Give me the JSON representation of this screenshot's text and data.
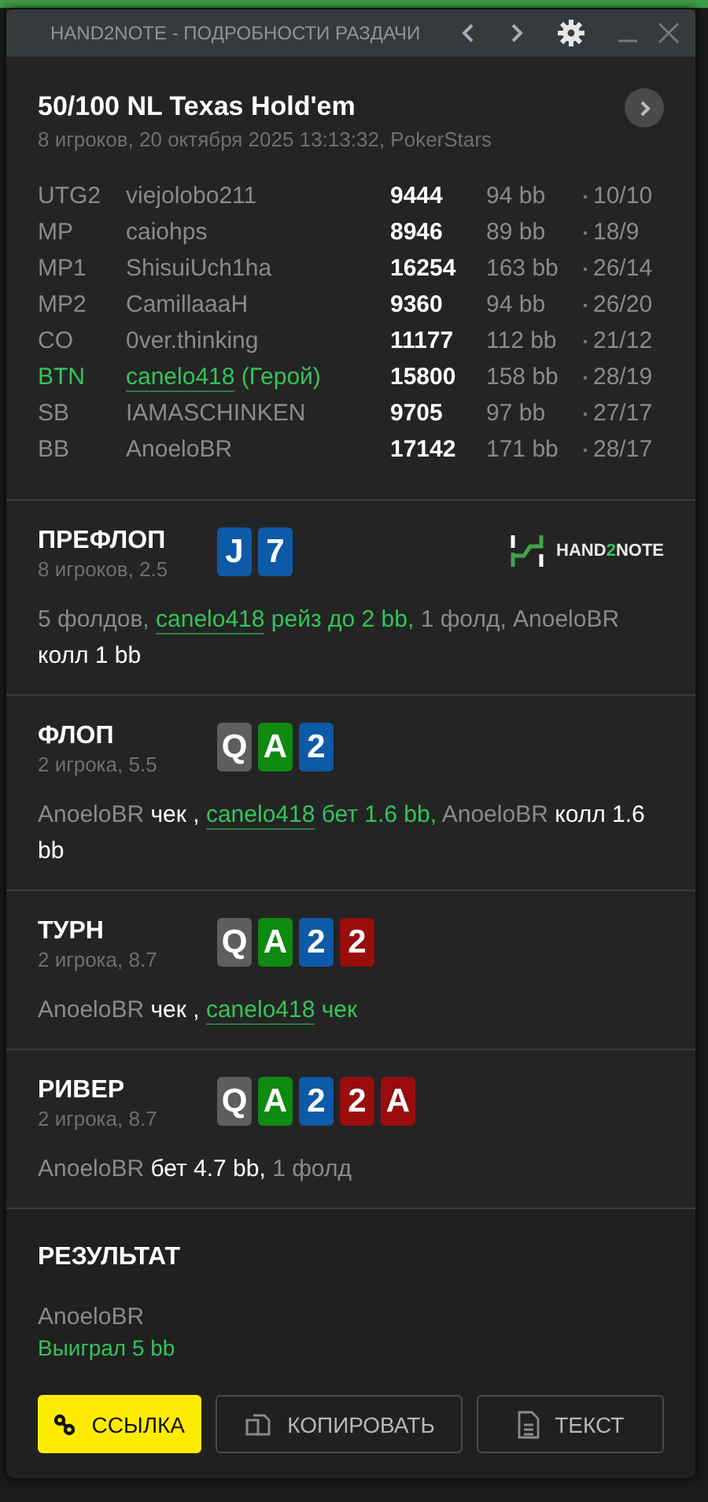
{
  "window": {
    "title": "HAND2NOTE - ПОДРОБНОСТИ РАЗДАЧИ"
  },
  "hand": {
    "title": "50/100 NL Texas Hold'em",
    "subtitle": "8 игроков, 20 октября 2025 13:13:32, PokerStars"
  },
  "players": [
    {
      "position": "UTG2",
      "name": "viejolobo211",
      "stack": "9444",
      "bb": "94 bb",
      "stats": "10/10",
      "hero": false
    },
    {
      "position": "MP",
      "name": "caiohps",
      "stack": "8946",
      "bb": "89 bb",
      "stats": "18/9",
      "hero": false
    },
    {
      "position": "MP1",
      "name": "ShisuiUch1ha",
      "stack": "16254",
      "bb": "163 bb",
      "stats": "26/14",
      "hero": false
    },
    {
      "position": "MP2",
      "name": "CamillaaaH",
      "stack": "9360",
      "bb": "94 bb",
      "stats": "26/20",
      "hero": false
    },
    {
      "position": "CO",
      "name": "0ver.thinking",
      "stack": "11177",
      "bb": "112 bb",
      "stats": "21/12",
      "hero": false
    },
    {
      "position": "BTN",
      "name": "canelo418",
      "tag": "(Герой)",
      "stack": "15800",
      "bb": "158 bb",
      "stats": "28/19",
      "hero": true
    },
    {
      "position": "SB",
      "name": "IAMASCHINKEN",
      "stack": "9705",
      "bb": "97 bb",
      "stats": "27/17",
      "hero": false
    },
    {
      "position": "BB",
      "name": "AnoeloBR",
      "stack": "17142",
      "bb": "171 bb",
      "stats": "28/17",
      "hero": false
    }
  ],
  "streets": [
    {
      "name": "ПРЕФЛОП",
      "info": "8 игроков, 2.5",
      "cards": [
        {
          "rank": "J",
          "color": "#0d5aa7"
        },
        {
          "rank": "7",
          "color": "#0d5aa7"
        }
      ],
      "logo": [
        {
          "text": "HAND",
          "accent": false
        },
        {
          "text": "2",
          "accent": true
        },
        {
          "text": "NOTE",
          "accent": false
        }
      ],
      "actions": [
        {
          "text": "5 фолдов, ",
          "kind": "dim"
        },
        {
          "text": "canelo418",
          "kind": "hero"
        },
        {
          "text": " рейз до 2 bb,",
          "kind": "hero_move"
        },
        {
          "text": " 1 фолд, AnoeloBR ",
          "kind": "dim"
        },
        {
          "text": "колл 1 bb",
          "kind": "move"
        }
      ]
    },
    {
      "name": "ФЛОП",
      "info": "2 игрока, 5.5",
      "cards": [
        {
          "rank": "Q",
          "color": "#5e5e5e"
        },
        {
          "rank": "A",
          "color": "#0e8a10"
        },
        {
          "rank": "2",
          "color": "#0d5aa7"
        }
      ],
      "actions": [
        {
          "text": "AnoeloBR ",
          "kind": "dim"
        },
        {
          "text": "чек , ",
          "kind": "move"
        },
        {
          "text": "canelo418",
          "kind": "hero"
        },
        {
          "text": " бет 1.6 bb,",
          "kind": "hero_move"
        },
        {
          "text": " AnoeloBR ",
          "kind": "dim"
        },
        {
          "text": "колл 1.6 bb",
          "kind": "move"
        }
      ]
    },
    {
      "name": "ТУРН",
      "info": "2 игрока, 8.7",
      "cards": [
        {
          "rank": "Q",
          "color": "#5e5e5e"
        },
        {
          "rank": "A",
          "color": "#0e8a10"
        },
        {
          "rank": "2",
          "color": "#0d5aa7"
        },
        {
          "rank": "2",
          "color": "#990d0d"
        }
      ],
      "actions": [
        {
          "text": "AnoeloBR ",
          "kind": "dim"
        },
        {
          "text": "чек , ",
          "kind": "move"
        },
        {
          "text": "canelo418",
          "kind": "hero"
        },
        {
          "text": " чек",
          "kind": "hero_move"
        }
      ]
    },
    {
      "name": "РИВЕР",
      "info": "2 игрока, 8.7",
      "cards": [
        {
          "rank": "Q",
          "color": "#5e5e5e"
        },
        {
          "rank": "A",
          "color": "#0e8a10"
        },
        {
          "rank": "2",
          "color": "#0d5aa7"
        },
        {
          "rank": "2",
          "color": "#990d0d"
        },
        {
          "rank": "A",
          "color": "#990d0d"
        }
      ],
      "actions": [
        {
          "text": "AnoeloBR ",
          "kind": "dim"
        },
        {
          "text": "бет 4.7 bb,",
          "kind": "move"
        },
        {
          "text": " 1 фолд",
          "kind": "dim"
        }
      ]
    }
  ],
  "result": {
    "title": "РЕЗУЛЬТАТ",
    "player": "AnoeloBR",
    "outcome": "Выиграл 5 bb"
  },
  "buttons": [
    {
      "label": "ССЫЛКА",
      "kind": "link"
    },
    {
      "label": "КОПИРОВАТЬ",
      "kind": "copy"
    },
    {
      "label": "ТЕКСТ",
      "kind": "text"
    }
  ]
}
